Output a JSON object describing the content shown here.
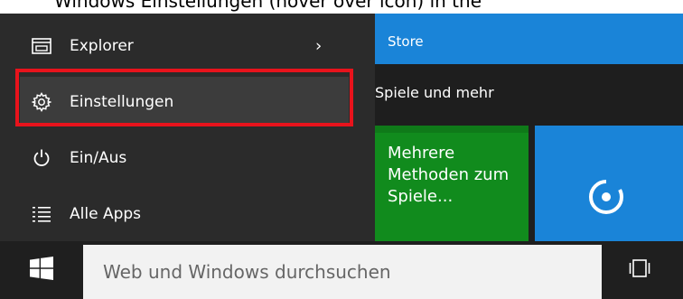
{
  "caption": {
    "text": "Windows Einstellungen (hover over icon) in the"
  },
  "start_menu": {
    "items": [
      {
        "label": "Explorer",
        "icon": "file-explorer-icon",
        "has_submenu": true,
        "chevron": "›"
      },
      {
        "label": "Einstellungen",
        "icon": "gear-icon",
        "highlighted": true
      },
      {
        "label": "Ein/Aus",
        "icon": "power-icon"
      },
      {
        "label": "Alle Apps",
        "icon": "all-apps-list-icon"
      }
    ]
  },
  "tiles": {
    "store_label": "Store",
    "group_label": "Spiele und mehr",
    "games_tile_text": "Mehrere Methoden zum Spiele...",
    "music_tile_icon": "groove-music-icon"
  },
  "taskbar": {
    "start_icon": "windows-logo-icon",
    "search_placeholder": "Web und Windows durchsuchen",
    "taskview_icon": "task-view-icon"
  },
  "colors": {
    "start_menu_bg": "#2b2b2b",
    "highlight_border": "#e8131c",
    "store_blue": "#1a84d8",
    "games_green": "#118b1d",
    "taskbar_bg": "#1f1f1f"
  }
}
